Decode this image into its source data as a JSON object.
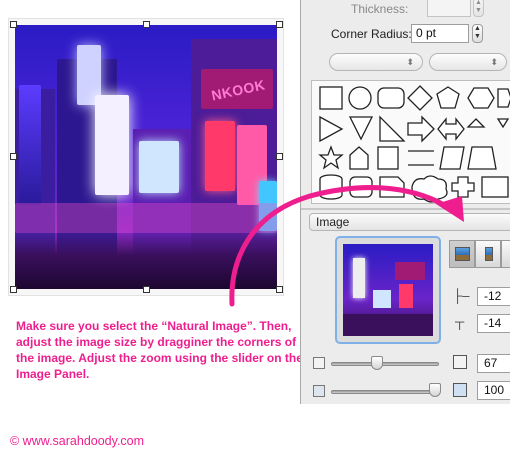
{
  "caption": {
    "text": "Make sure you select the “Natural Image”. Then, adjust the image size by dragginer the corners of the image. Adjust the zoom using the slider on the Image Panel."
  },
  "copyright": "© www.sarahdoody.com",
  "photo": {
    "sign_text": "NKOOK"
  },
  "inspector": {
    "thickness_label": "Thickness:",
    "corner_radius_label": "Corner Radius:",
    "corner_radius_value": "0 pt",
    "image_section_label": "Image",
    "position_x_value": "-12",
    "position_y_value": "-14",
    "size_value": "67",
    "zoom_value": "100"
  },
  "colors": {
    "accent_pink": "#ee1e8e",
    "selection_blue": "#7fb0e8"
  }
}
